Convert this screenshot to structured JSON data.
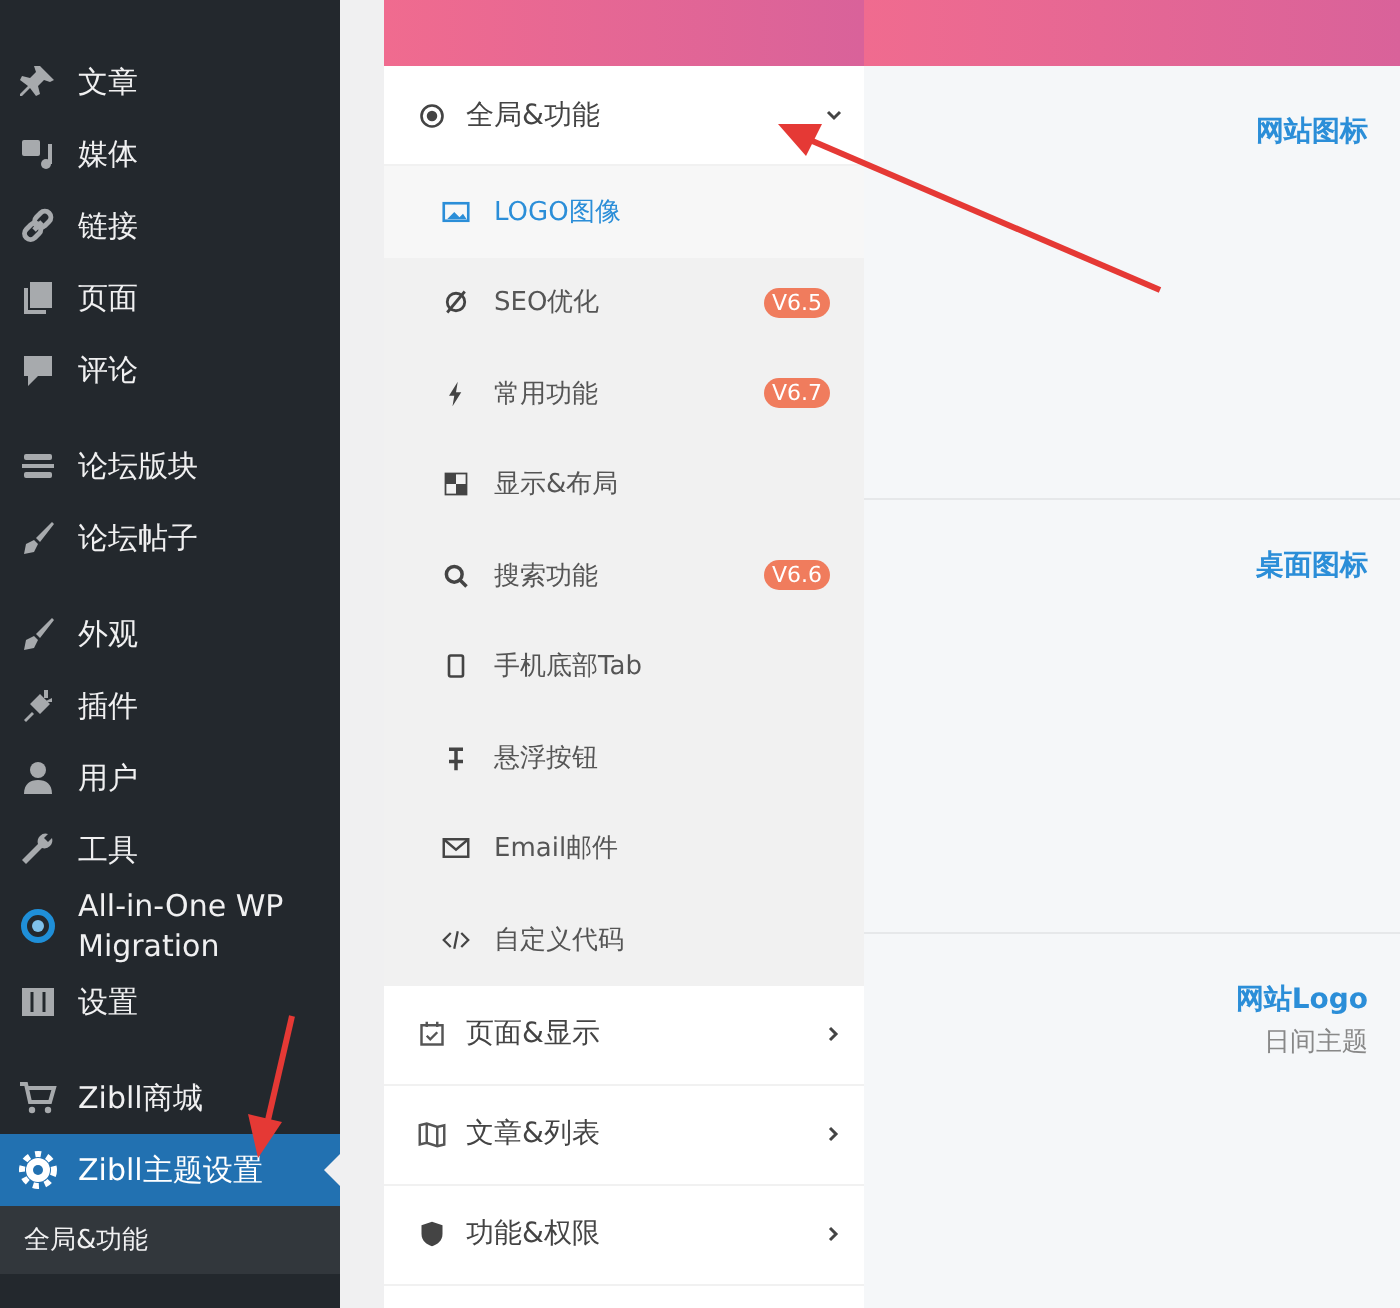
{
  "sidebar": {
    "sections": [
      {
        "items": [
          {
            "label": "文章",
            "selected": false
          },
          {
            "label": "媒体",
            "selected": false
          },
          {
            "label": "链接",
            "selected": false
          },
          {
            "label": "页面",
            "selected": false
          },
          {
            "label": "评论",
            "selected": false
          }
        ]
      },
      {
        "items": [
          {
            "label": "论坛版块",
            "selected": false
          },
          {
            "label": "论坛帖子",
            "selected": false
          }
        ]
      },
      {
        "items": [
          {
            "label": "外观",
            "selected": false
          },
          {
            "label": "插件",
            "selected": false
          },
          {
            "label": "用户",
            "selected": false
          },
          {
            "label": "工具",
            "selected": false
          },
          {
            "label": "All-in-One WP Migration",
            "selected": false
          },
          {
            "label": "设置",
            "selected": false
          }
        ]
      },
      {
        "items": [
          {
            "label": "Zibll商城",
            "selected": false
          },
          {
            "label": "Zibll主题设置",
            "selected": true
          }
        ]
      }
    ],
    "submenu": [
      {
        "label": "全局&功能"
      }
    ]
  },
  "settings_nav": {
    "groups": [
      {
        "label": "全局&功能",
        "expanded": true,
        "children": [
          {
            "label": "LOGO图像",
            "selected": true
          },
          {
            "label": "SEO优化",
            "selected": false,
            "badge": "V6.5"
          },
          {
            "label": "常用功能",
            "selected": false,
            "badge": "V6.7"
          },
          {
            "label": "显示&布局",
            "selected": false
          },
          {
            "label": "搜索功能",
            "selected": false,
            "badge": "V6.6"
          },
          {
            "label": "手机底部Tab",
            "selected": false
          },
          {
            "label": "悬浮按钮",
            "selected": false
          },
          {
            "label": "Email邮件",
            "selected": false
          },
          {
            "label": "自定义代码",
            "selected": false
          }
        ]
      },
      {
        "label": "页面&显示",
        "expanded": false
      },
      {
        "label": "文章&列表",
        "expanded": false
      },
      {
        "label": "功能&权限",
        "expanded": false
      }
    ]
  },
  "fields": [
    {
      "title": "网站图标"
    },
    {
      "title": "桌面图标"
    },
    {
      "title": "网站Logo",
      "subtitle": "日间主题"
    }
  ]
}
